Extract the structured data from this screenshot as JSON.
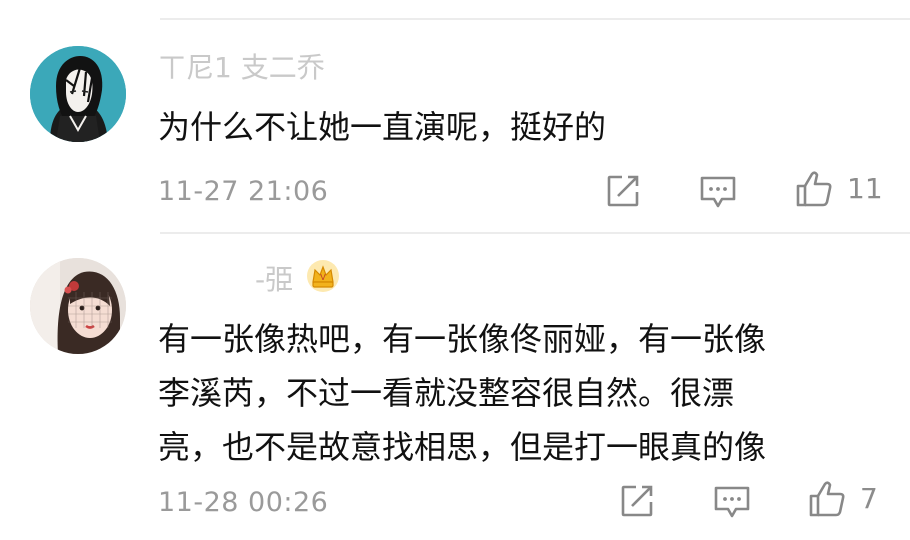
{
  "comments": [
    {
      "username": "ㄒ尼1  支二乔",
      "text": "为什么不让她一直演呢，挺好的",
      "timestamp": "11-27 21:06",
      "like_count": "11",
      "avatar_bg": "#3ba8b9"
    },
    {
      "username": "-弫",
      "text_lines": [
        "有一张像热吧，有一张像佟丽娅，有一张像",
        "李溪芮，不过一看就没整容很自然。很漂",
        "亮，也不是故意找相思，但是打一眼真的像"
      ],
      "timestamp": "11-28 00:26",
      "like_count": "7",
      "avatar_bg": "#e8e1dc"
    }
  ],
  "colors": {
    "text": "#111111",
    "meta": "#9a9a9a",
    "icon": "#888888",
    "badge": "#f2b21c",
    "divider": "#ececec"
  },
  "icons": [
    "share-icon",
    "comment-icon",
    "thumbs-up-icon",
    "vip-crown-badge"
  ]
}
